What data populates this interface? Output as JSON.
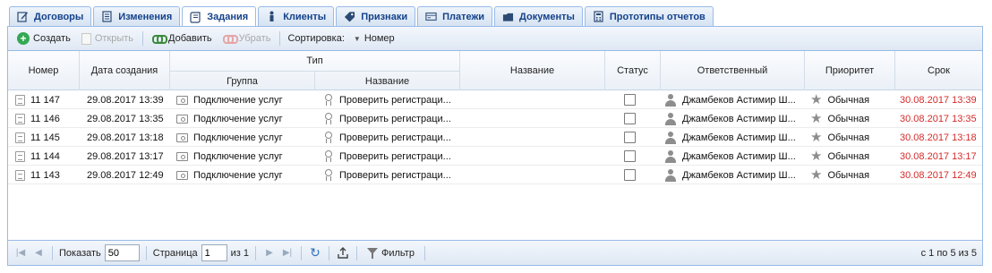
{
  "tabs": [
    {
      "label": "Договоры",
      "icon": "edit-icon",
      "active": false
    },
    {
      "label": "Изменения",
      "icon": "document-icon",
      "active": false
    },
    {
      "label": "Задания",
      "icon": "task-icon",
      "active": true
    },
    {
      "label": "Клиенты",
      "icon": "person-icon",
      "active": false
    },
    {
      "label": "Признаки",
      "icon": "tag-icon",
      "active": false
    },
    {
      "label": "Платежи",
      "icon": "card-icon",
      "active": false
    },
    {
      "label": "Документы",
      "icon": "folder-icon",
      "active": false
    },
    {
      "label": "Прототипы отчетов",
      "icon": "calculator-icon",
      "active": false
    }
  ],
  "toolbar": {
    "create_label": "Создать",
    "open_label": "Открыть",
    "add_label": "Добавить",
    "remove_label": "Убрать",
    "sort_label": "Сортировка:",
    "sort_value": "Номер"
  },
  "columns": {
    "number": "Номер",
    "created": "Дата создания",
    "type": "Тип",
    "group": "Группа",
    "type_name": "Название",
    "name": "Название",
    "status": "Статус",
    "responsible": "Ответственный",
    "priority": "Приоритет",
    "deadline": "Срок"
  },
  "rows": [
    {
      "number": "11 147",
      "created": "29.08.2017 13:39",
      "group": "Подключение услуг",
      "type_name": "Проверить регистраци...",
      "name": "",
      "responsible": "Джамбеков Астимир Ш...",
      "priority": "Обычная",
      "deadline": "30.08.2017 13:39"
    },
    {
      "number": "11 146",
      "created": "29.08.2017 13:35",
      "group": "Подключение услуг",
      "type_name": "Проверить регистраци...",
      "name": "",
      "responsible": "Джамбеков Астимир Ш...",
      "priority": "Обычная",
      "deadline": "30.08.2017 13:35"
    },
    {
      "number": "11 145",
      "created": "29.08.2017 13:18",
      "group": "Подключение услуг",
      "type_name": "Проверить регистраци...",
      "name": "",
      "responsible": "Джамбеков Астимир Ш...",
      "priority": "Обычная",
      "deadline": "30.08.2017 13:18"
    },
    {
      "number": "11 144",
      "created": "29.08.2017 13:17",
      "group": "Подключение услуг",
      "type_name": "Проверить регистраци...",
      "name": "",
      "responsible": "Джамбеков Астимир Ш...",
      "priority": "Обычная",
      "deadline": "30.08.2017 13:17"
    },
    {
      "number": "11 143",
      "created": "29.08.2017 12:49",
      "group": "Подключение услуг",
      "type_name": "Проверить регистраци...",
      "name": "",
      "responsible": "Джамбеков Астимир Ш...",
      "priority": "Обычная",
      "deadline": "30.08.2017 12:49"
    }
  ],
  "pager": {
    "show_label": "Показать",
    "page_size": "50",
    "page_label": "Страница",
    "page_value": "1",
    "of_label": "из 1",
    "filter_label": "Фильтр",
    "summary": "с 1 по 5 из 5"
  },
  "colors": {
    "accent": "#15428b",
    "border": "#99bbe8",
    "deadline": "#d62b2b"
  }
}
